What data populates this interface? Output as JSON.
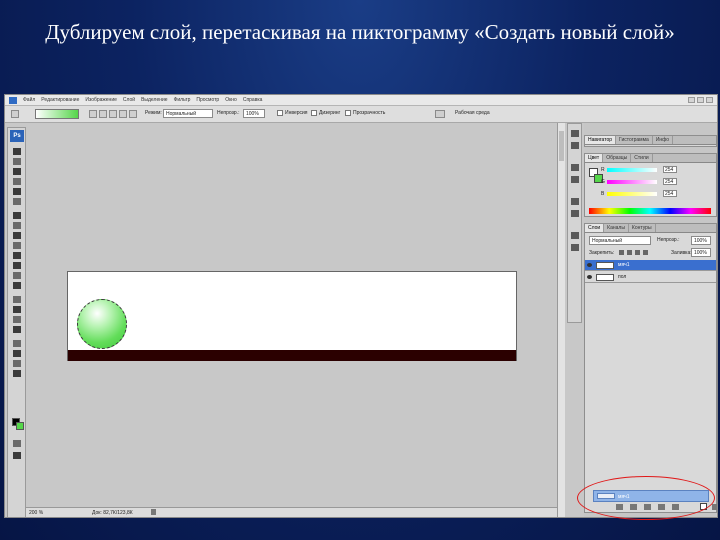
{
  "slide": {
    "title": "Дублируем слой, перетаскивая на пиктограмму «Создать новый слой»"
  },
  "menubar": {
    "items": [
      "Файл",
      "Редактирование",
      "Изображение",
      "Слой",
      "Выделение",
      "Фильтр",
      "Просмотр",
      "Окно",
      "Справка"
    ]
  },
  "options_bar": {
    "mode_label": "Режим:",
    "mode_value": "Нормальный",
    "opacity_label": "Непрозр.:",
    "opacity_value": "100%",
    "inverse_label": "Инверсия",
    "dither_label": "Дизеринг",
    "transparency_label": "Прозрачность",
    "workspace_label": "Рабочая среда"
  },
  "toolbox": {
    "badge": "Ps"
  },
  "status_bar": {
    "zoom": "200 %",
    "doc_info": "Док: 82,7К/123,8К"
  },
  "navigator_panel": {
    "tabs": [
      "Навигатор",
      "Гистограмма",
      "Инфо"
    ]
  },
  "color_panel": {
    "tabs": [
      "Цвет",
      "Образцы",
      "Стили"
    ],
    "channels": [
      {
        "label": "R",
        "value": "254"
      },
      {
        "label": "G",
        "value": "254"
      },
      {
        "label": "B",
        "value": "254"
      }
    ]
  },
  "layers_panel": {
    "tabs": [
      "Слои",
      "Каналы",
      "Контуры"
    ],
    "blend_mode": "Нормальный",
    "opacity_label": "Непрозр.:",
    "opacity_value": "100%",
    "lock_label": "Закрепить:",
    "fill_label": "Заливка:",
    "fill_value": "100%",
    "layers": [
      {
        "name": "мяч1",
        "selected": true
      },
      {
        "name": "пол",
        "selected": false
      }
    ],
    "dragged_layer": {
      "name": "мяч1"
    }
  },
  "colors": {
    "slide_bg": "#0c2361",
    "highlight_ellipse": "#e01818",
    "selected_layer": "#3a6fcf",
    "ball_green": "#55d64a",
    "floor": "#2b0000"
  }
}
